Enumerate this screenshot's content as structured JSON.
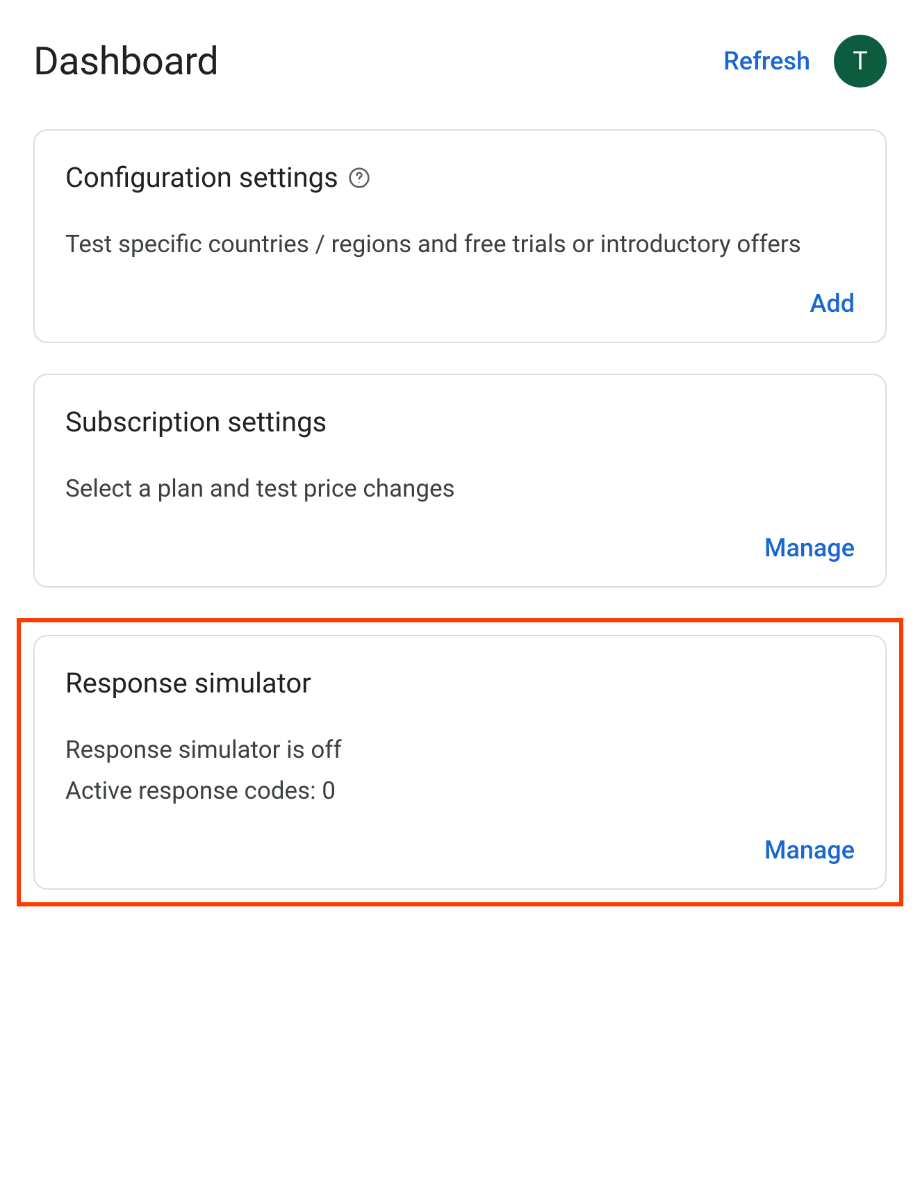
{
  "header": {
    "title": "Dashboard",
    "refresh_label": "Refresh",
    "avatar_initial": "T"
  },
  "cards": {
    "config": {
      "title": "Configuration settings",
      "has_help_icon": true,
      "description": "Test specific countries / regions and free trials or introductory offers",
      "action_label": "Add",
      "highlighted": false
    },
    "subscription": {
      "title": "Subscription settings",
      "has_help_icon": false,
      "description": "Select a plan and test price changes",
      "action_label": "Manage",
      "highlighted": false
    },
    "simulator": {
      "title": "Response simulator",
      "has_help_icon": false,
      "description": "Response simulator is off",
      "extra_line": "Active response codes: 0",
      "action_label": "Manage",
      "highlighted": true
    }
  }
}
